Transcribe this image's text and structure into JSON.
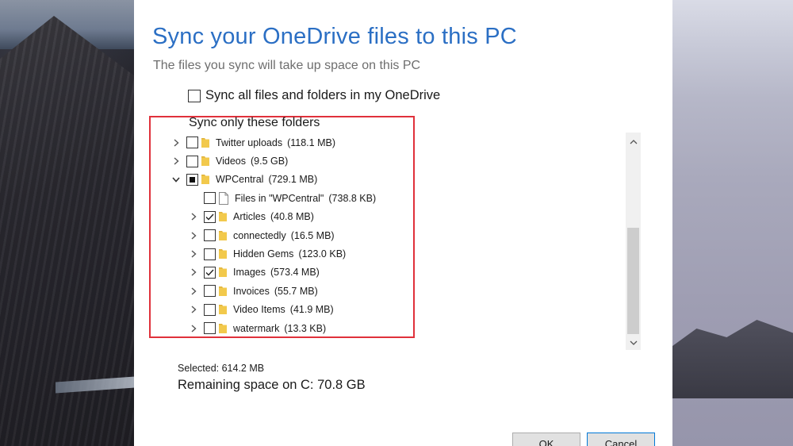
{
  "dialog": {
    "title": "Sync your OneDrive files to this PC",
    "subtitle": "The files you sync will take up space on this PC",
    "sync_all_label": "Sync all files and folders in my OneDrive",
    "sync_all_checked": false,
    "folders_label": "Sync only these folders",
    "folders": [
      {
        "label": "Twitter uploads",
        "size": "(118.1 MB)",
        "level": 1,
        "state": "unchecked",
        "type": "folder",
        "expander": "collapsed"
      },
      {
        "label": "Videos",
        "size": "(9.5 GB)",
        "level": 1,
        "state": "unchecked",
        "type": "folder",
        "expander": "collapsed"
      },
      {
        "label": "WPCentral",
        "size": "(729.1 MB)",
        "level": 1,
        "state": "partial",
        "type": "folder",
        "expander": "expanded"
      },
      {
        "label": "Files in \"WPCentral\"",
        "size": "(738.8 KB)",
        "level": 2,
        "state": "unchecked",
        "type": "file",
        "expander": "none"
      },
      {
        "label": "Articles",
        "size": "(40.8 MB)",
        "level": 2,
        "state": "checked",
        "type": "folder",
        "expander": "collapsed"
      },
      {
        "label": "connectedly",
        "size": "(16.5 MB)",
        "level": 2,
        "state": "unchecked",
        "type": "folder",
        "expander": "collapsed"
      },
      {
        "label": "Hidden Gems",
        "size": "(123.0 KB)",
        "level": 2,
        "state": "unchecked",
        "type": "folder",
        "expander": "collapsed"
      },
      {
        "label": "Images",
        "size": "(573.4 MB)",
        "level": 2,
        "state": "checked",
        "type": "folder",
        "expander": "collapsed"
      },
      {
        "label": "Invoices",
        "size": "(55.7 MB)",
        "level": 2,
        "state": "unchecked",
        "type": "folder",
        "expander": "collapsed"
      },
      {
        "label": "Video Items",
        "size": "(41.9 MB)",
        "level": 2,
        "state": "unchecked",
        "type": "folder",
        "expander": "collapsed"
      },
      {
        "label": "watermark",
        "size": "(13.3 KB)",
        "level": 2,
        "state": "unchecked",
        "type": "folder",
        "expander": "collapsed"
      }
    ],
    "selected_text": "Selected: 614.2 MB",
    "remaining_text": "Remaining space on C: 70.8 GB",
    "ok_label": "OK",
    "cancel_label": "Cancel"
  },
  "colors": {
    "title": "#2b6fc4",
    "highlight_box": "#e0313b",
    "folder_icon": "#f2c94c"
  },
  "icons": {
    "expander_collapsed": "chevron-right-icon",
    "expander_expanded": "chevron-down-icon",
    "folder": "folder-icon",
    "file": "file-icon"
  }
}
